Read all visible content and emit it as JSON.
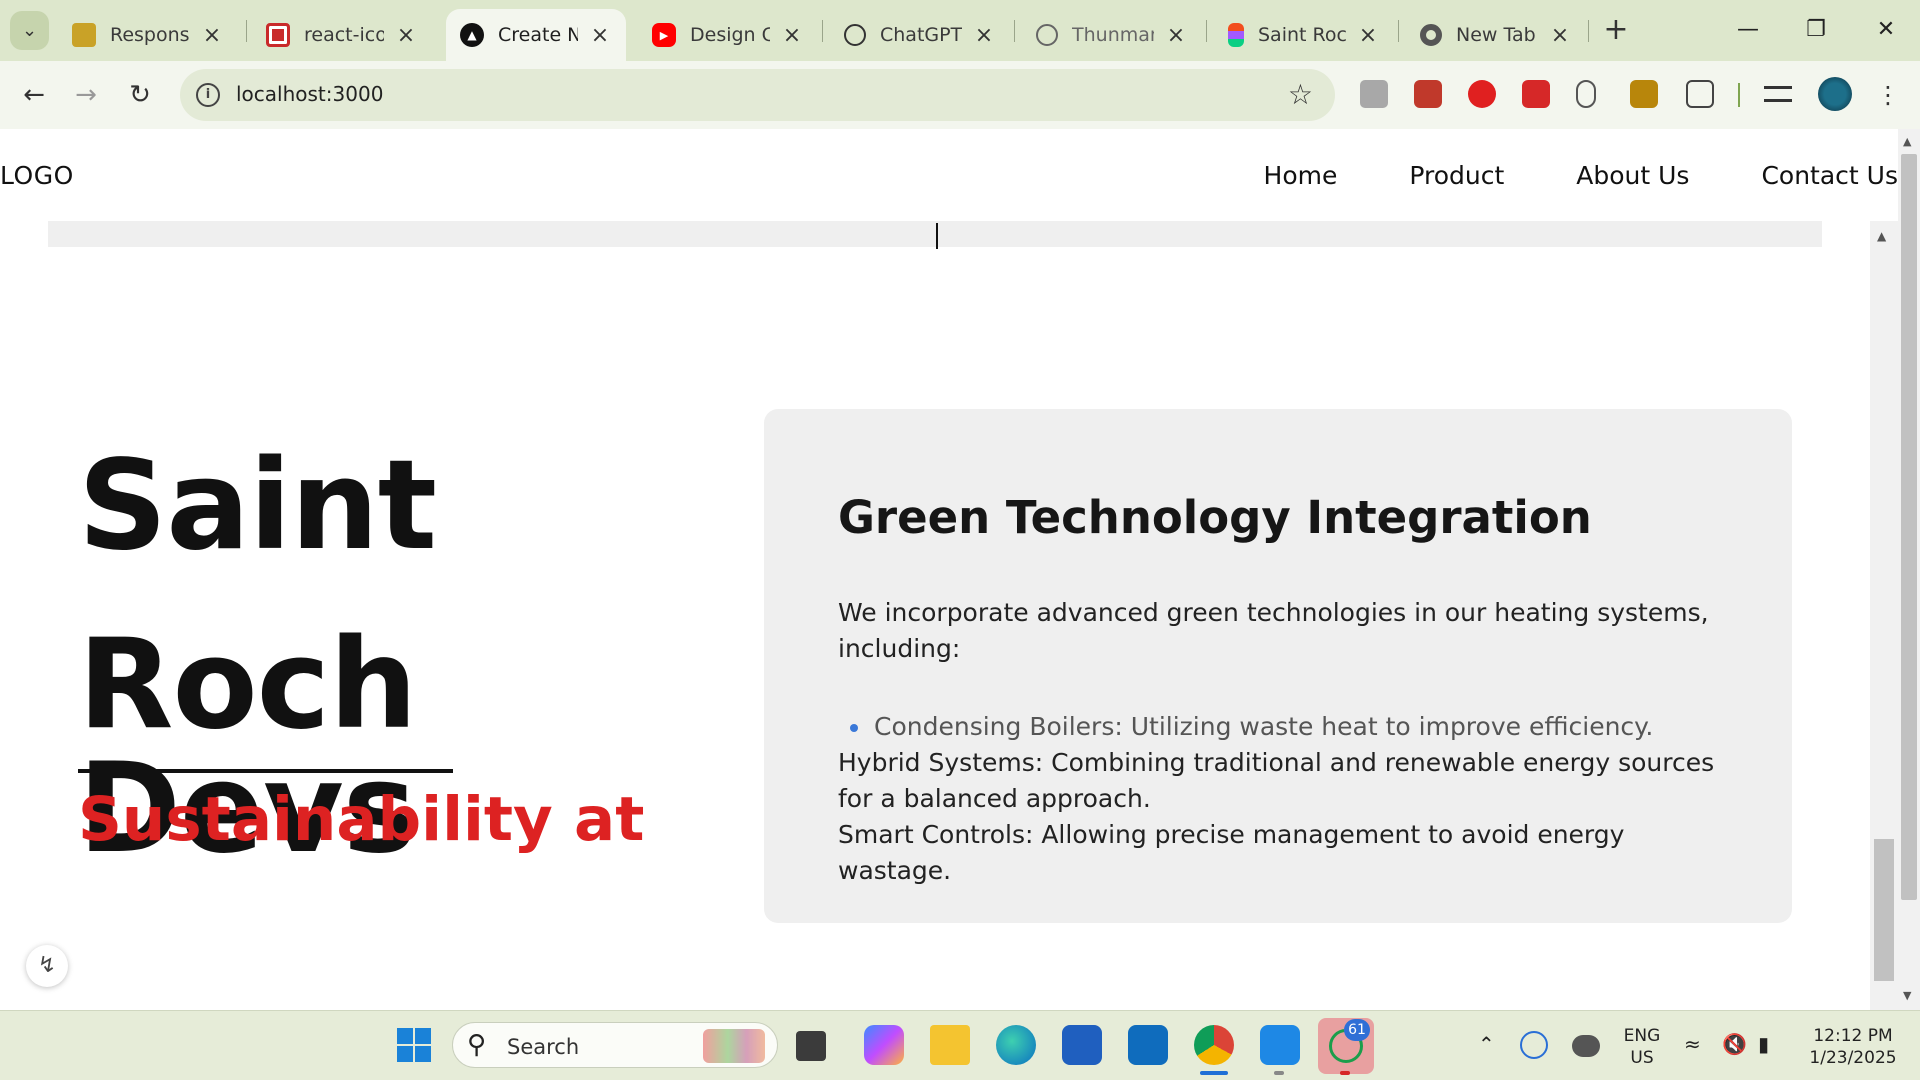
{
  "browser": {
    "tabs": [
      {
        "title": "Responsive",
        "favicon": "folder-icon",
        "active": false
      },
      {
        "title": "react-icons",
        "favicon": "react-icons-icon",
        "active": false
      },
      {
        "title": "Create Nex",
        "favicon": "vercel-icon",
        "active": true
      },
      {
        "title": "Design Car",
        "favicon": "youtube-icon",
        "active": false
      },
      {
        "title": "ChatGPT",
        "favicon": "chatgpt-icon",
        "active": false
      },
      {
        "title": "Thunmans",
        "favicon": "tampermonkey-icon",
        "active": false
      },
      {
        "title": "Saint Roch",
        "favicon": "figma-icon",
        "active": false
      },
      {
        "title": "New Tab",
        "favicon": "chrome-icon",
        "active": false
      }
    ],
    "url": "localhost:3000"
  },
  "page": {
    "navbar": {
      "logo": "LOGO",
      "links": [
        "Home",
        "Product",
        "About Us",
        "Contact Us"
      ]
    },
    "hero": {
      "title_line1": "Saint",
      "title_line2": "Roch Devs",
      "subtitle": "Sustainability at"
    },
    "card": {
      "heading": "Green Technology Integration",
      "intro": "We incorporate advanced green technologies in our heating systems, including:",
      "bullet": "Condensing Boilers: Utilizing waste heat to improve efficiency.",
      "hybrid": "Hybrid Systems: Combining traditional and renewable energy sources for a balanced approach.",
      "smart": "Smart Controls: Allowing precise management to avoid energy wastage."
    }
  },
  "taskbar": {
    "search_placeholder": "Search",
    "language": "ENG",
    "region": "US",
    "time": "12:12 PM",
    "date": "1/23/2025",
    "whatsapp_badge": "61"
  },
  "colors": {
    "accent_red": "#dd2222",
    "bullet_blue": "#3a78d8",
    "chrome_green": "#dde7cc"
  }
}
